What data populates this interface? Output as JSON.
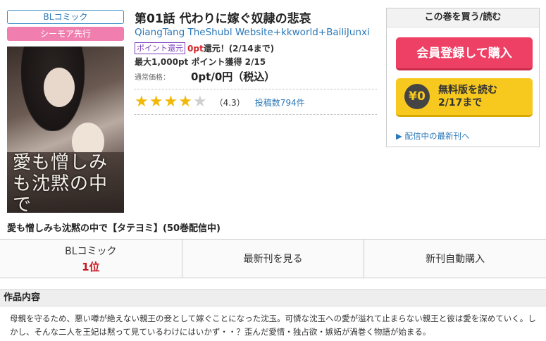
{
  "left": {
    "badge_bl": "BLコミック",
    "badge_cmoa": "シーモア先行",
    "cover_title": "愛も憎しみも沈黙の中で",
    "series_title": "愛も憎しみも沈黙の中で【タテヨミ】(50巻配信中)"
  },
  "main": {
    "episode_title": "第01話 代わりに嫁ぐ奴隷の悲哀",
    "authors": "QiangTang TheShubl Website+kkworld+BailiJunxi",
    "point_tag": "ポイント還元",
    "point_red": "0pt",
    "point_rest": "還元！(2/14まで)",
    "max_points": "最大1,000pt ポイント獲得 2/15",
    "price_label": "通常価格：",
    "price_value": "0pt/0円（税込）",
    "rating_stars": 4,
    "rating_value": "（4.3）",
    "review_count": "投稿数794件"
  },
  "buybox": {
    "title": "この巻を買う/読む",
    "buy_label": "会員登録して購入",
    "yen_icon": "¥0",
    "free_line1": "無料版を読む",
    "free_line2": "2/17まで",
    "latest_link": "▶ 配信中の最新刊へ"
  },
  "tabs": {
    "genre_label": "BLコミック",
    "genre_rank": "1位",
    "latest_label": "最新刊を見る",
    "auto_buy_label": "新刊自動購入"
  },
  "description": {
    "heading": "作品内容",
    "body": "母親を守るため、悪い噂が絶えない親王の妾として嫁ぐことになった沈玉。可憐な沈玉への愛が溢れて止まらない親王と彼は愛を深めていく。しかし、そんな二人を王妃は黙って見ているわけにはいかず・・？歪んだ愛情・独占欲・嫉妬が渦巻く物語が始まる。"
  },
  "colors": {
    "accent_blue": "#2b78b8",
    "buy_pink": "#ee3f64",
    "free_yellow": "#f7c91e",
    "rank_red": "#c8151b",
    "star_gold": "#f2b807"
  }
}
